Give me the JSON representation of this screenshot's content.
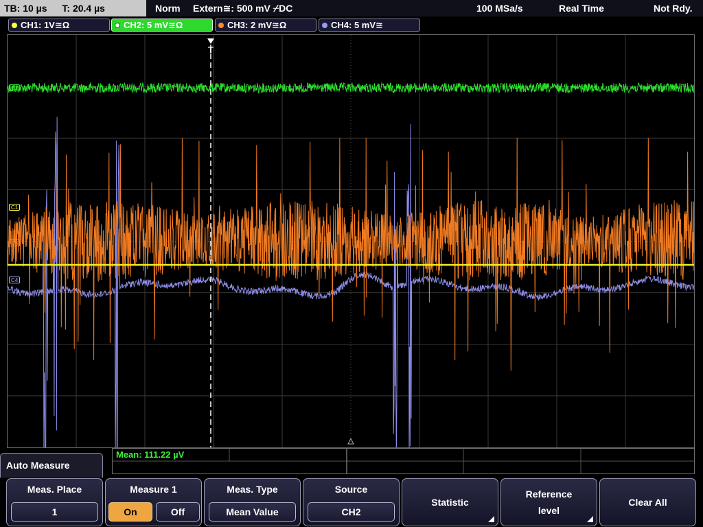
{
  "topbar": {
    "timebase": "TB: 10 µs",
    "trigger_time": "T: 20.4 µs",
    "mode": "Norm",
    "trigger_source": "Extern≅: 500 mV ⌿DC",
    "sample_rate": "100 MSa/s",
    "acq_mode": "Real Time",
    "status": "Not Rdy."
  },
  "channels": [
    {
      "label": "CH1: 1V≅Ω",
      "color": "#ffff3c"
    },
    {
      "label": "CH2: 5 mV≅Ω",
      "color": "#3cf03c"
    },
    {
      "label": "CH3: 2 mV≅Ω",
      "color": "#ff8a2a"
    },
    {
      "label": "CH4: 5 mV≅",
      "color": "#9a9af0"
    }
  ],
  "markers": {
    "c2": "C2",
    "c1": "C1",
    "c3": "C3",
    "c4": "C4",
    "trigger": "T"
  },
  "measurement": {
    "mean": "Mean: 111.22 µV"
  },
  "menu": {
    "title": "Auto Measure",
    "meas_place_label": "Meas. Place",
    "meas_place_value": "1",
    "measure1_label": "Measure 1",
    "on": "On",
    "off": "Off",
    "meas_type_label": "Meas. Type",
    "meas_type_value": "Mean Value",
    "source_label": "Source",
    "source_value": "CH2",
    "statistic": "Statistic",
    "reference_level_1": "Reference",
    "reference_level_2": "level",
    "clear_all": "Clear All"
  }
}
